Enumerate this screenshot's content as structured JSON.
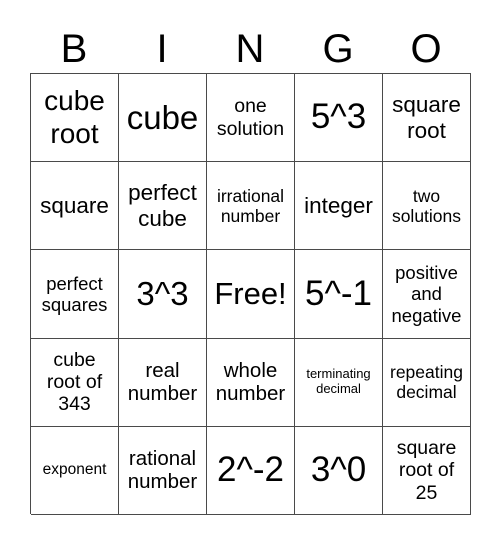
{
  "header": [
    "B",
    "I",
    "N",
    "G",
    "O"
  ],
  "cells": [
    [
      "cube root",
      "cube",
      "one solution",
      "5^3",
      "square root"
    ],
    [
      "square",
      "perfect cube",
      "irrational number",
      "integer",
      "two solutions"
    ],
    [
      "perfect squares",
      "3^3",
      "Free!",
      "5^-1",
      "positive and negative"
    ],
    [
      "cube root of 343",
      "real number",
      "whole number",
      "terminating decimal",
      "repeating decimal"
    ],
    [
      "exponent",
      "rational number",
      "2^-2",
      "3^0",
      "square root of 25"
    ]
  ]
}
